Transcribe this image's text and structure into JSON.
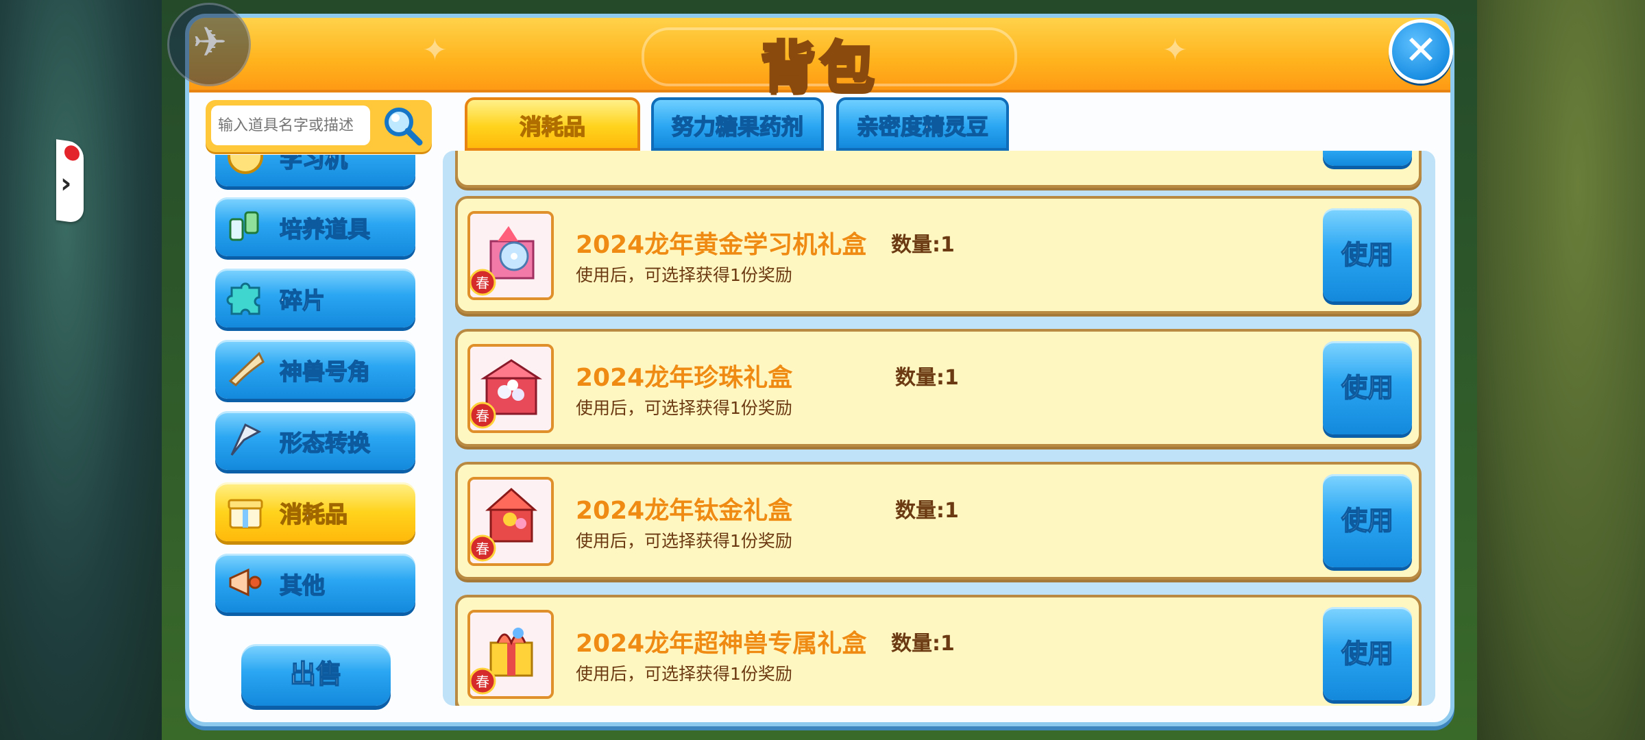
{
  "window": {
    "title": "背包",
    "close_icon": "close-icon"
  },
  "search": {
    "placeholder": "输入道具名字或描述",
    "icon": "magnifier-icon"
  },
  "sidebar": {
    "items": [
      {
        "label": "学习机",
        "icon": "learning-machine-icon",
        "active": false
      },
      {
        "label": "培养道具",
        "icon": "training-items-icon",
        "active": false
      },
      {
        "label": "碎片",
        "icon": "puzzle-fragment-icon",
        "active": false
      },
      {
        "label": "神兽号角",
        "icon": "horn-icon",
        "active": false
      },
      {
        "label": "形态转换",
        "icon": "transform-icon",
        "active": false
      },
      {
        "label": "消耗品",
        "icon": "gift-box-icon",
        "active": true
      },
      {
        "label": "其他",
        "icon": "megaphone-icon",
        "active": false
      }
    ],
    "sell_label": "出售"
  },
  "tabs": [
    {
      "label": "消耗品",
      "active": true
    },
    {
      "label": "努力糖果药剂",
      "active": false
    },
    {
      "label": "亲密度精灵豆",
      "active": false
    }
  ],
  "items": [
    {
      "name": "2024龙年黄金学习机礼盒",
      "quantity": "数量:1",
      "description": "使用后，可选择获得1份奖励",
      "use_label": "使用",
      "badge": "春",
      "icon": "gold-learning-gift-icon"
    },
    {
      "name": "2024龙年珍珠礼盒",
      "quantity": "数量:1",
      "description": "使用后，可选择获得1份奖励",
      "use_label": "使用",
      "badge": "春",
      "icon": "pearl-gift-icon"
    },
    {
      "name": "2024龙年钛金礼盒",
      "quantity": "数量:1",
      "description": "使用后，可选择获得1份奖励",
      "use_label": "使用",
      "badge": "春",
      "icon": "titanium-gift-icon"
    },
    {
      "name": "2024龙年超神兽专属礼盒",
      "quantity": "数量:1",
      "description": "使用后，可选择获得1份奖励",
      "use_label": "使用",
      "badge": "春",
      "icon": "super-beast-gift-icon"
    }
  ],
  "colors": {
    "title_bar": "#ffb31d",
    "accent_blue": "#1b8fe3",
    "item_bg": "#fff7c2",
    "item_name": "#ef8a12"
  }
}
